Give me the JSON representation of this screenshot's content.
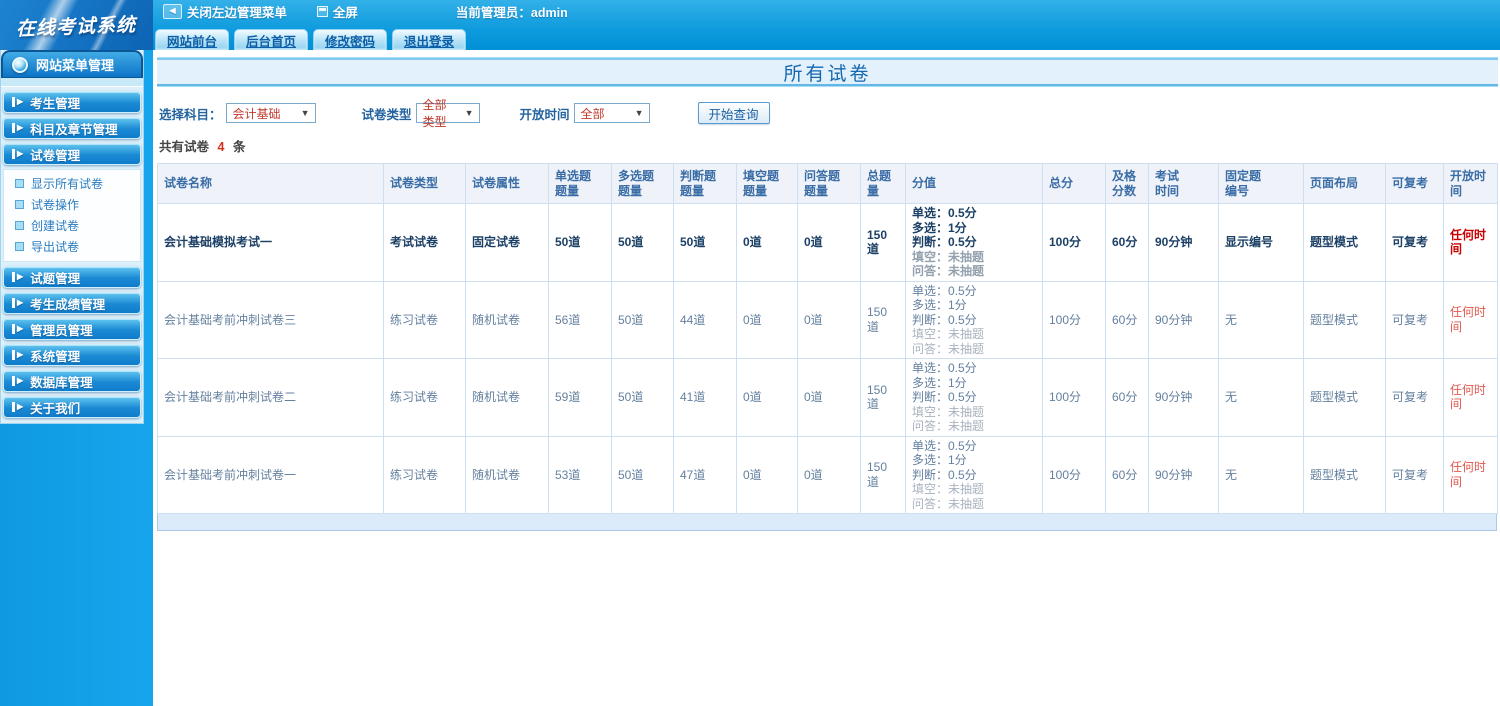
{
  "theme": {
    "accent_blue": "#0099e0",
    "title_blue": "#1568b0",
    "alert_red": "#cc0000",
    "count_red": "#d2311e"
  },
  "icons": {
    "back": "◄",
    "caret": "▼",
    "menu_arrow": "▶"
  },
  "topbar": {
    "logo": "在线考试系统",
    "close_menu": "关闭左边管理菜单",
    "fullscreen": "全屏",
    "admin": "当前管理员：admin",
    "tabs": [
      "网站前台",
      "后台首页",
      "修改密码",
      "退出登录"
    ]
  },
  "sidebar": {
    "title": "网站菜单管理",
    "top_items": [
      "考生管理",
      "科目及章节管理",
      "试卷管理"
    ],
    "submenu": [
      "显示所有试卷",
      "试卷操作",
      "创建试卷",
      "导出试卷"
    ],
    "bottom_items": [
      "试题管理",
      "考生成绩管理",
      "管理员管理",
      "系统管理",
      "数据库管理",
      "关于我们"
    ]
  },
  "main": {
    "title": "所有试卷",
    "filters": {
      "subject_label": "选择科目：",
      "subject_value": "会计基础",
      "type_label": "试卷类型",
      "type_value": "全部类型",
      "open_label": "开放时间",
      "open_value": "全部",
      "search_button": "开始查询"
    },
    "count": {
      "prefix": "共有试卷",
      "value": "4",
      "suffix": "条"
    }
  },
  "table": {
    "headers": [
      {
        "a": "试卷名称"
      },
      {
        "a": "试卷类型"
      },
      {
        "a": "试卷属性"
      },
      {
        "a": "单选题",
        "b": "题量"
      },
      {
        "a": "多选题",
        "b": "题量"
      },
      {
        "a": "判断题",
        "b": "题量"
      },
      {
        "a": "填空题",
        "b": "题量"
      },
      {
        "a": "问答题",
        "b": "题量"
      },
      {
        "a": "总题量"
      },
      {
        "a": "分值"
      },
      {
        "a": "总分"
      },
      {
        "a": "及格",
        "b": "分数"
      },
      {
        "a": "考试",
        "b": "时间"
      },
      {
        "a": "固定题",
        "b": "编号"
      },
      {
        "a": "页面布局"
      },
      {
        "a": "可复考"
      },
      {
        "a": "开放时间"
      }
    ],
    "rows": [
      {
        "name": "会计基础模拟考试一",
        "type": "考试试卷",
        "attr": "固定试卷",
        "single": "50道",
        "multi": "50道",
        "judge": "50道",
        "blank": "0道",
        "qa": "0道",
        "total": "150道",
        "score_lines": [
          "单选：0.5分",
          "多选：1分",
          "判断：0.5分",
          "填空：未抽题",
          "问答：未抽题"
        ],
        "total_score": "100分",
        "pass_score": "60分",
        "exam_time": "90分钟",
        "fixed_no": "显示编号",
        "layout": "题型模式",
        "retake": "可复考",
        "open_time": "任何时间"
      },
      {
        "name": "会计基础考前冲刺试卷三",
        "type": "练习试卷",
        "attr": "随机试卷",
        "single": "56道",
        "multi": "50道",
        "judge": "44道",
        "blank": "0道",
        "qa": "0道",
        "total": "150道",
        "score_lines": [
          "单选：0.5分",
          "多选：1分",
          "判断：0.5分",
          "填空：未抽题",
          "问答：未抽题"
        ],
        "total_score": "100分",
        "pass_score": "60分",
        "exam_time": "90分钟",
        "fixed_no": "无",
        "layout": "题型模式",
        "retake": "可复考",
        "open_time": "任何时间"
      },
      {
        "name": "会计基础考前冲刺试卷二",
        "type": "练习试卷",
        "attr": "随机试卷",
        "single": "59道",
        "multi": "50道",
        "judge": "41道",
        "blank": "0道",
        "qa": "0道",
        "total": "150道",
        "score_lines": [
          "单选：0.5分",
          "多选：1分",
          "判断：0.5分",
          "填空：未抽题",
          "问答：未抽题"
        ],
        "total_score": "100分",
        "pass_score": "60分",
        "exam_time": "90分钟",
        "fixed_no": "无",
        "layout": "题型模式",
        "retake": "可复考",
        "open_time": "任何时间"
      },
      {
        "name": "会计基础考前冲刺试卷一",
        "type": "练习试卷",
        "attr": "随机试卷",
        "single": "53道",
        "multi": "50道",
        "judge": "47道",
        "blank": "0道",
        "qa": "0道",
        "total": "150道",
        "score_lines": [
          "单选：0.5分",
          "多选：1分",
          "判断：0.5分",
          "填空：未抽题",
          "问答：未抽题"
        ],
        "total_score": "100分",
        "pass_score": "60分",
        "exam_time": "90分钟",
        "fixed_no": "无",
        "layout": "题型模式",
        "retake": "可复考",
        "open_time": "任何时间"
      }
    ]
  }
}
